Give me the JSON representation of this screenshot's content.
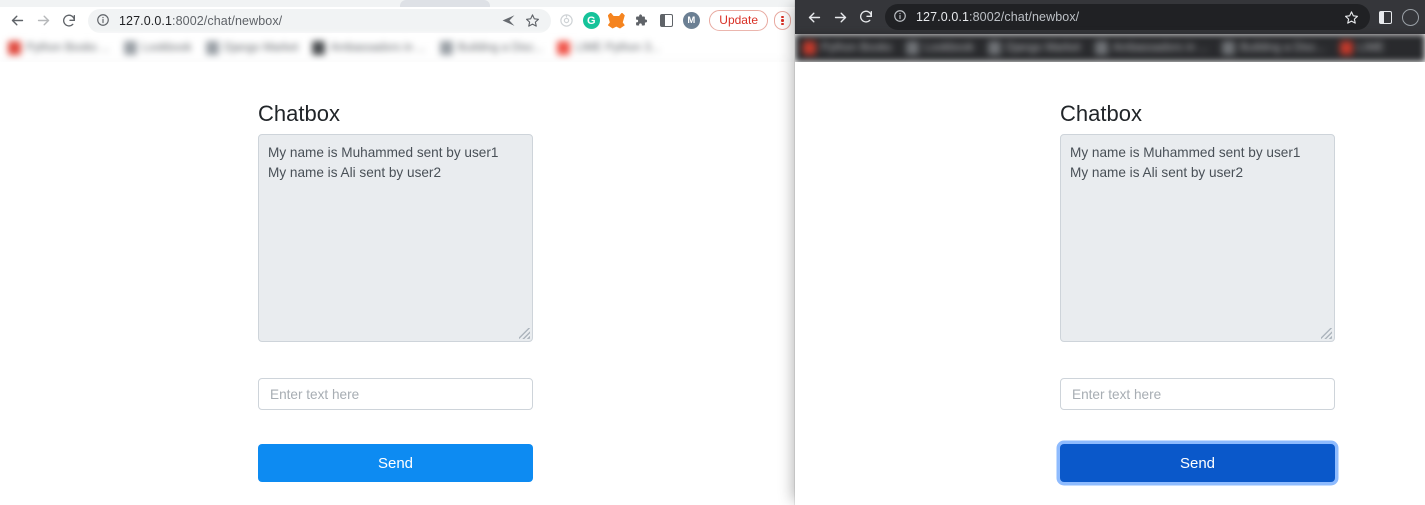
{
  "windows": {
    "left": {
      "theme": "light",
      "address_bar": {
        "host": "127.0.0.1",
        "path": ":8002/chat/newbox/",
        "security_icon": "info-circle-icon"
      },
      "nav": {
        "back": "back-icon",
        "forward": "forward-icon",
        "reload": "reload-icon"
      },
      "omnibox_actions": [
        {
          "name": "share-icon",
          "glyph": "➤"
        },
        {
          "name": "bookmark-star-icon",
          "glyph": "☆"
        }
      ],
      "extensions": [
        {
          "name": "target-icon",
          "label": ""
        },
        {
          "name": "grammarly-icon",
          "label": "G"
        },
        {
          "name": "metamask-fox-icon",
          "label": ""
        },
        {
          "name": "extensions-puzzle-icon",
          "label": ""
        },
        {
          "name": "side-panel-icon",
          "label": ""
        },
        {
          "name": "profile-avatar",
          "label": "M"
        }
      ],
      "update_button": "Update",
      "menu_button": "chrome-menu-icon",
      "bookmarks": [
        {
          "label": "Python Books ...",
          "color": "#e04a3f"
        },
        {
          "label": "Lookbook",
          "color": "#8c9196"
        },
        {
          "label": "Django Market",
          "color": "#8c9196"
        },
        {
          "label": "Ambassadors in ...",
          "color": "#4a4d50"
        },
        {
          "label": "Building a Disc...",
          "color": "#8c9196"
        },
        {
          "label": "LIME Python 3...",
          "color": "#f0554a"
        }
      ]
    },
    "right": {
      "theme": "dark",
      "address_bar": {
        "host": "127.0.0.1",
        "path": ":8002/chat/newbox/",
        "security_icon": "info-circle-icon"
      },
      "nav": {
        "back": "back-icon",
        "forward": "forward-icon",
        "reload": "reload-icon"
      },
      "omnibox_actions": [
        {
          "name": "bookmark-star-icon",
          "glyph": "☆"
        }
      ],
      "extensions": [
        {
          "name": "side-panel-icon",
          "label": ""
        },
        {
          "name": "profile-avatar",
          "label": ""
        }
      ],
      "bookmarks": [
        {
          "label": "Python Books",
          "color": "#c0392b"
        },
        {
          "label": "Lookbook",
          "color": "#6f7276"
        },
        {
          "label": "Django Market",
          "color": "#6f7276"
        },
        {
          "label": "Ambassadors in ...",
          "color": "#6f7276"
        },
        {
          "label": "Building a Disc...",
          "color": "#6f7276"
        },
        {
          "label": "LIME",
          "color": "#c0392b"
        }
      ]
    }
  },
  "page": {
    "title": "Chatbox",
    "messages": [
      "My name is Muhammed sent by user1",
      "My name is Ali sent by user2"
    ],
    "input": {
      "value": "",
      "placeholder": "Enter text here"
    },
    "send_button": {
      "label": "Send"
    }
  },
  "colors": {
    "send_primary": "#0d8bf2",
    "send_active": "#0a58ca",
    "focus_ring": "#3184fd",
    "chat_bg": "#e9ecef",
    "chat_border": "#ced4da",
    "update_red": "#d93025",
    "dark_toolbar": "#35363a",
    "dark_omnibox": "#202124",
    "dark_bookmarks": "#292a2d"
  }
}
